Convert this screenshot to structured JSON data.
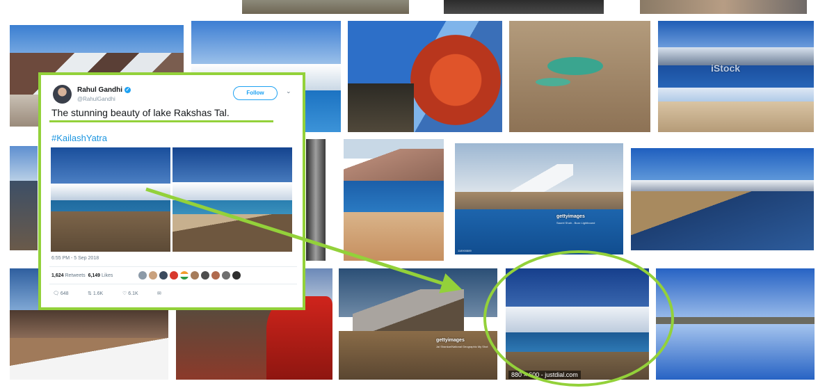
{
  "tweet": {
    "user_name": "Rahul Gandhi",
    "handle": "@RahulGandhi",
    "follow_label": "Follow",
    "text": "The stunning beauty of lake Rakshas Tal.",
    "hashtag": "#KailashYatra",
    "timestamp": "6:55 PM - 5 Sep 2018",
    "retweets_count": "1,624",
    "retweets_label": "Retweets",
    "likes_count": "6,149",
    "likes_label": "Likes",
    "reply_count": "648",
    "retweet_action_count": "1.6K",
    "like_action_count": "6.1K"
  },
  "results": {
    "watermark_istock": "iStock",
    "watermark_getty_1": "gettyimages",
    "watermark_getty_1_sub": "Saurel Shah - Buzz Lightbound",
    "watermark_getty_2": "gettyimages",
    "watermark_getty_2_sub": "Jai Shankar/National Geographic My Shot",
    "image_id_small": "118900889",
    "matched_dimensions": "880 × 600 - justdial.com"
  },
  "colors": {
    "highlight_green": "#93d13a",
    "twitter_blue": "#1da1f2"
  }
}
